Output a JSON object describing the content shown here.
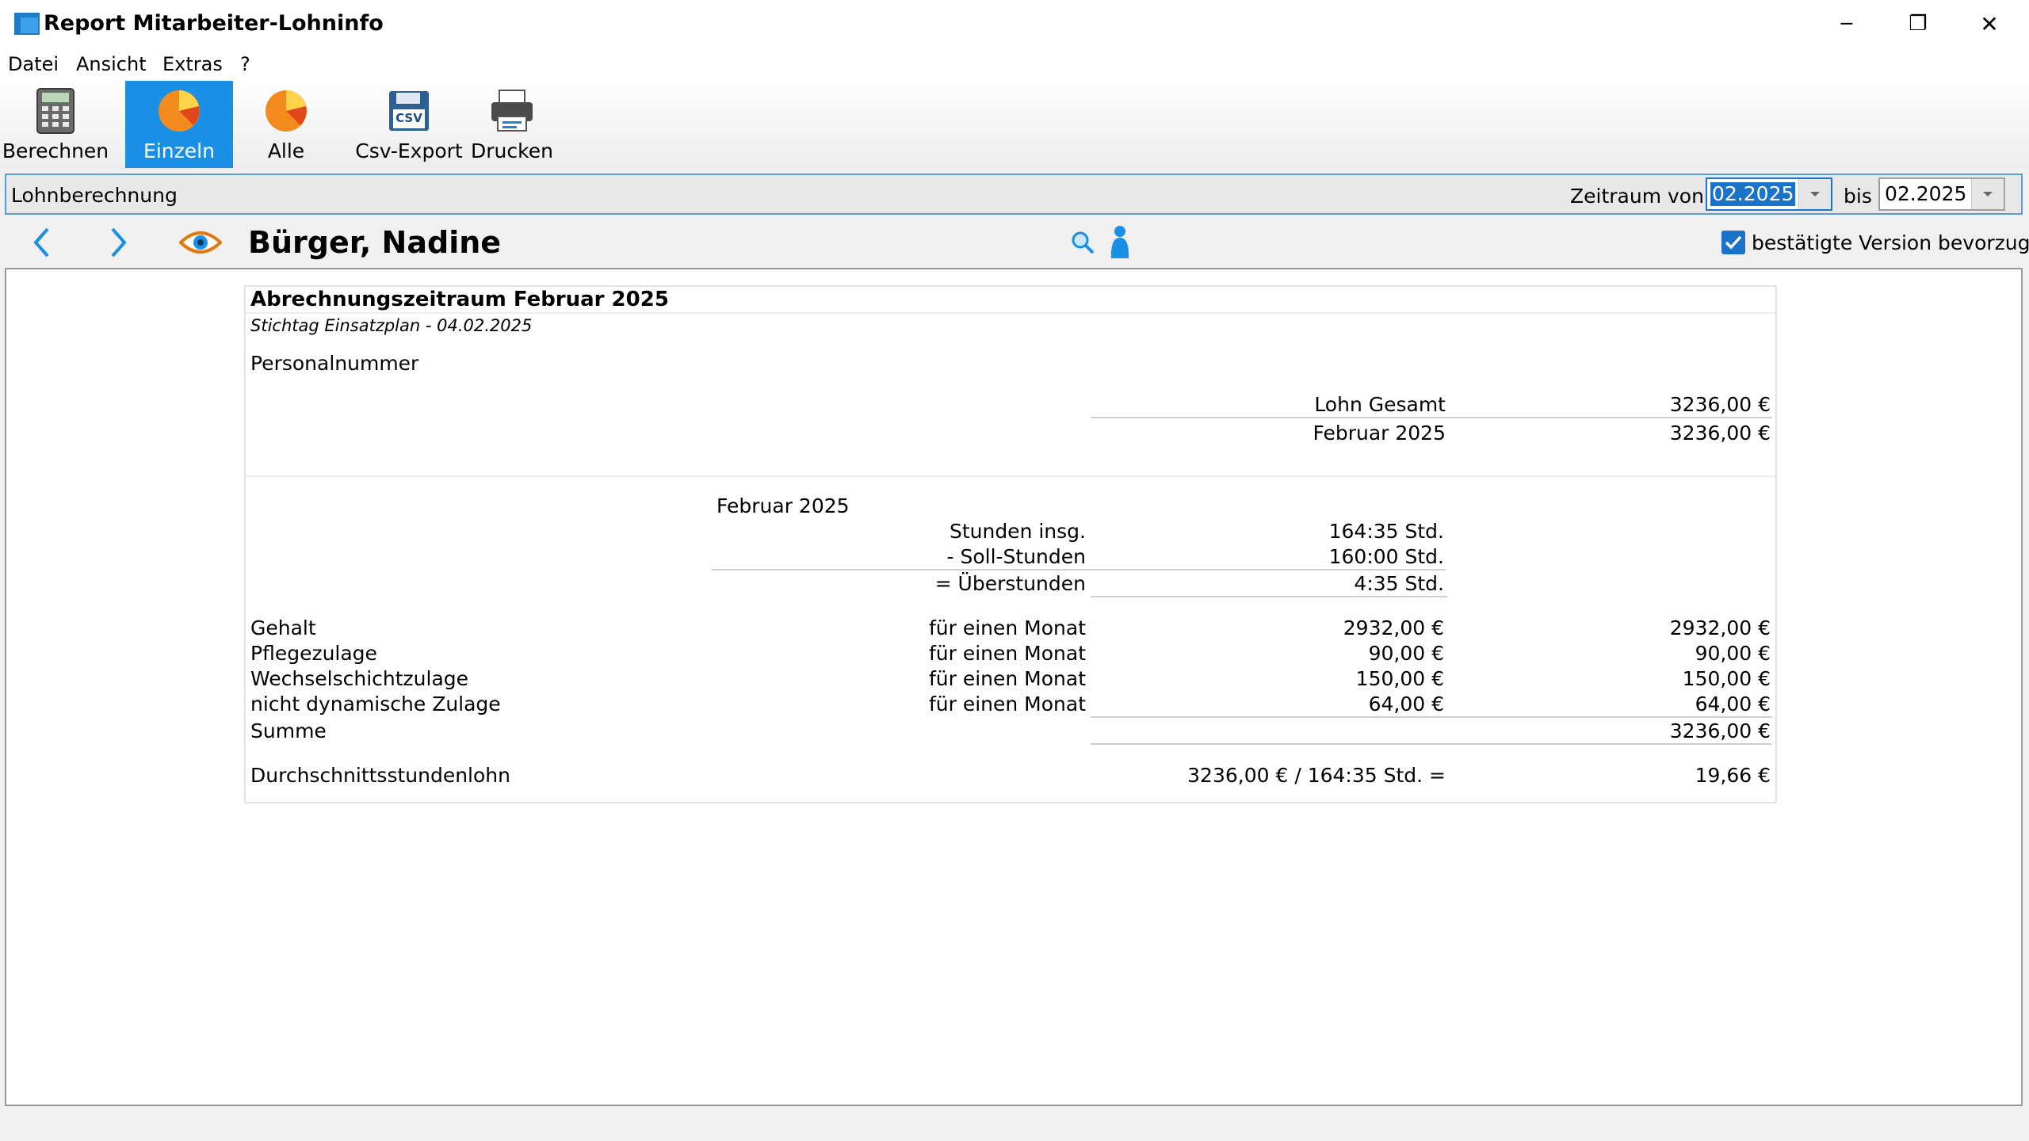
{
  "window": {
    "title": "Report Mitarbeiter-Lohninfo",
    "minimize_glyph": "─",
    "restore_glyph": "❐",
    "close_glyph": "✕"
  },
  "menu": [
    "Datei",
    "Ansicht",
    "Extras",
    "?"
  ],
  "toolbar": {
    "berechnen": "Berechnen",
    "einzeln": "Einzeln",
    "alle": "Alle",
    "csv_export": "Csv-Export",
    "csv_icon_text": "CSV",
    "drucken": "Drucken",
    "active": "Einzeln"
  },
  "header": {
    "title": "Lohnberechnung",
    "zeitraum_label": "Zeitraum von",
    "von_value": "02.2025",
    "bis_label": "bis",
    "bis_value": "02.2025"
  },
  "nav": {
    "employee_name": "Bürger, Nadine",
    "prefer_confirmed_label": "bestätigte Version bevorzugen",
    "prefer_confirmed_checked": true
  },
  "report": {
    "period_title": "Abrechnungszeitraum Februar 2025",
    "stichtag": "Stichtag Einsatzplan - 04.02.2025",
    "personalnummer_label": "Personalnummer",
    "lohn_gesamt_label": "Lohn Gesamt",
    "lohn_gesamt_value": "3236,00 €",
    "month_label": "Februar 2025",
    "month_value": "3236,00 €",
    "section_month": "Februar 2025",
    "hours": {
      "total_label": "Stunden insg.",
      "total_value": "164:35 Std.",
      "soll_label": "- Soll-Stunden",
      "soll_value": "160:00 Std.",
      "ueber_label": "= Überstunden",
      "ueber_value": "4:35 Std."
    },
    "items": [
      {
        "name": "Gehalt",
        "period": "für einen Monat",
        "rate": "2932,00 €",
        "total": "2932,00 €"
      },
      {
        "name": "Pflegezulage",
        "period": "für einen Monat",
        "rate": "90,00 €",
        "total": "90,00 €"
      },
      {
        "name": "Wechselschichtzulage",
        "period": "für einen Monat",
        "rate": "150,00 €",
        "total": "150,00 €"
      },
      {
        "name": "nicht dynamische Zulage",
        "period": "für einen Monat",
        "rate": "64,00 €",
        "total": "64,00 €"
      }
    ],
    "summe_label": "Summe",
    "summe_value": "3236,00 €",
    "avg_label": "Durchschnittsstundenlohn",
    "avg_formula": "3236,00 € / 164:35 Std. =",
    "avg_value": "19,66 €"
  },
  "colors": {
    "accent": "#1a8fe6",
    "band_border": "#5a9bd8",
    "selection": "#1a73c9"
  }
}
